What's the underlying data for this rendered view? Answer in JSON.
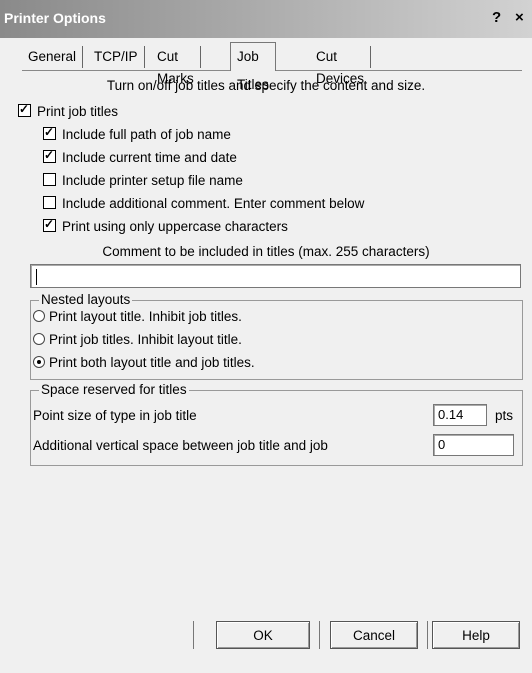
{
  "window": {
    "title": "Printer Options",
    "help_button": "?",
    "close_button": "×"
  },
  "tabs": [
    {
      "label": "General",
      "active": false
    },
    {
      "label": "TCP/IP",
      "active": false
    },
    {
      "label": "Cut Marks",
      "active": false
    },
    {
      "label": "Job Titles",
      "active": true
    },
    {
      "label": "Cut Devices",
      "active": false
    }
  ],
  "intro_text": "Turn on/off job titles and specify the content and size.",
  "print_job_titles": {
    "label": "Print job titles",
    "checked": true
  },
  "options": [
    {
      "label": "Include full path of job name",
      "checked": true
    },
    {
      "label": "Include current time and date",
      "checked": true
    },
    {
      "label": "Include printer setup file name",
      "checked": false
    },
    {
      "label": "Include additional comment. Enter comment below",
      "checked": false
    },
    {
      "label": "Print using only uppercase characters",
      "checked": true
    }
  ],
  "comment": {
    "label": "Comment to be included in titles (max. 255 characters)",
    "value": ""
  },
  "nested_layouts": {
    "legend": "Nested layouts",
    "options": [
      {
        "label": "Print layout title. Inhibit job titles.",
        "selected": false
      },
      {
        "label": "Print job titles. Inhibit layout title.",
        "selected": false
      },
      {
        "label": "Print both layout title and job titles.",
        "selected": true
      }
    ]
  },
  "space_reserved": {
    "legend": "Space reserved for titles",
    "point_size": {
      "label": "Point size of type in job title",
      "value": "0.14",
      "unit": "pts"
    },
    "vertical_space": {
      "label": "Additional vertical space between job title and job",
      "value": "0"
    }
  },
  "buttons": {
    "ok": "OK",
    "cancel": "Cancel",
    "help": "Help"
  }
}
